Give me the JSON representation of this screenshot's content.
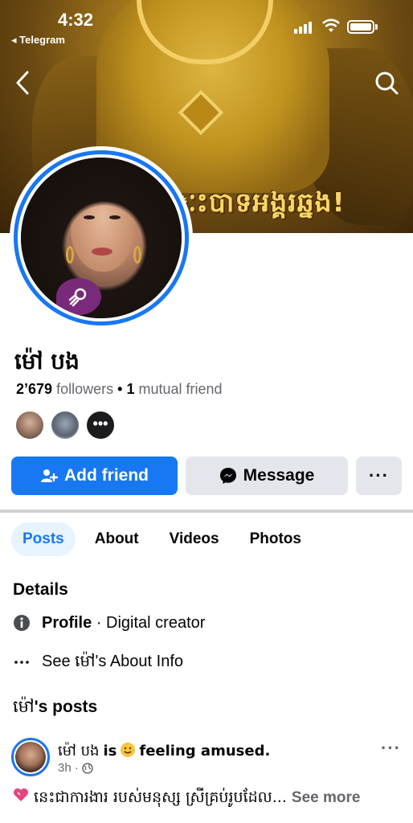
{
  "status_bar": {
    "time": "4:32",
    "back_app": "◂ Telegram"
  },
  "cover": {
    "banner_text": "ៈះបាទអង្គរឆ្នង!"
  },
  "profile": {
    "name": "ម៉ៅ បង",
    "followers_count": "2’679",
    "followers_label": "followers",
    "separator": "•",
    "mutual_count": "1",
    "mutual_label": "mutual friend",
    "more_friends_glyph": "•••"
  },
  "actions": {
    "add_friend": "Add friend",
    "message": "Message",
    "more": "···"
  },
  "tabs": [
    {
      "label": "Posts",
      "active": true
    },
    {
      "label": "About",
      "active": false
    },
    {
      "label": "Videos",
      "active": false
    },
    {
      "label": "Photos",
      "active": false
    }
  ],
  "details": {
    "title": "Details",
    "profile_label": "Profile",
    "profile_value": " · Digital creator",
    "about_prefix": "See ",
    "about_name": "ម៉ៅ",
    "about_suffix": "'s About Info"
  },
  "posts": {
    "title_name": "ម៉ៅ",
    "title_suffix": "'s posts",
    "post": {
      "author": "ម៉ៅ បង",
      "is": "is",
      "feeling": "feeling amused.",
      "time": "3h ·",
      "more": "···",
      "text": "នេះជាការងារ របស់មនុស្ស ស្រីគ្រប់រូបដែល...",
      "see_more": "See more"
    }
  },
  "colors": {
    "accent": "#1877f2",
    "button_gray": "#e4e6eb",
    "tab_active_bg": "#e7f3ff"
  }
}
